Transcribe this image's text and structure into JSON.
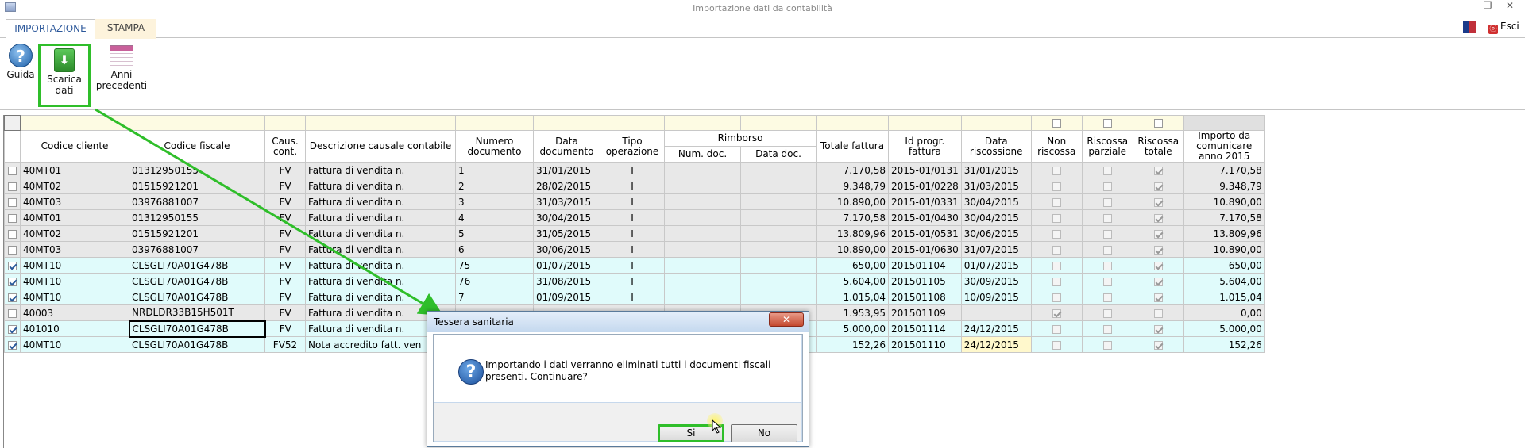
{
  "window": {
    "title": "Importazione dati da contabilità",
    "min": "–",
    "restore": "❐",
    "close": "✕"
  },
  "tabs": [
    {
      "label": "IMPORTAZIONE"
    },
    {
      "label": "STAMPA"
    }
  ],
  "toolbar": {
    "exit_label": "Esci",
    "exit_icon": "ⓞ",
    "guida": {
      "label": "Guida",
      "icon": "help-icon"
    },
    "scarica": {
      "label": "Scarica dati",
      "icon": "download-icon"
    },
    "anni": {
      "label": "Anni precedenti",
      "icon": "calendar-icon"
    }
  },
  "table": {
    "headers": {
      "codice_cliente": "Codice cliente",
      "codice_fiscale": "Codice fiscale",
      "caus_cont": "Caus. cont.",
      "descrizione": "Descrizione causale contabile",
      "numero_doc": "Numero documento",
      "data_doc": "Data documento",
      "tipo_op": "Tipo operazione",
      "rimborso": "Rimborso",
      "num_doc": "Num. doc.",
      "data_doc_r": "Data doc.",
      "totale": "Totale fattura",
      "id_progr": "Id progr. fattura",
      "data_risc": "Data riscossione",
      "non_risc": "Non riscossa",
      "risc_parz": "Riscossa parziale",
      "risc_tot": "Riscossa totale",
      "importo": "Importo da comunicare anno 2015"
    },
    "rows": [
      {
        "sel": false,
        "cliente": "40MT01",
        "cf": "01312950155",
        "caus": "FV",
        "desc": "Fattura di vendita n.",
        "num": "1",
        "data": "31/01/2015",
        "tipo": "I",
        "rnum": "",
        "rdata": "",
        "totale": "7.170,58",
        "id": "2015-01/0131",
        "drisc": "31/01/2015",
        "non": false,
        "parz": false,
        "tot": true,
        "importo": "7.170,58",
        "style": "r"
      },
      {
        "sel": false,
        "cliente": "40MT02",
        "cf": "01515921201",
        "caus": "FV",
        "desc": "Fattura di vendita n.",
        "num": "2",
        "data": "28/02/2015",
        "tipo": "I",
        "rnum": "",
        "rdata": "",
        "totale": "9.348,79",
        "id": "2015-01/0228",
        "drisc": "31/03/2015",
        "non": false,
        "parz": false,
        "tot": true,
        "importo": "9.348,79",
        "style": "r"
      },
      {
        "sel": false,
        "cliente": "40MT03",
        "cf": "03976881007",
        "caus": "FV",
        "desc": "Fattura di vendita n.",
        "num": "3",
        "data": "31/03/2015",
        "tipo": "I",
        "rnum": "",
        "rdata": "",
        "totale": "10.890,00",
        "id": "2015-01/0331",
        "drisc": "30/04/2015",
        "non": false,
        "parz": false,
        "tot": true,
        "importo": "10.890,00",
        "style": "r"
      },
      {
        "sel": false,
        "cliente": "40MT01",
        "cf": "01312950155",
        "caus": "FV",
        "desc": "Fattura di vendita n.",
        "num": "4",
        "data": "30/04/2015",
        "tipo": "I",
        "rnum": "",
        "rdata": "",
        "totale": "7.170,58",
        "id": "2015-01/0430",
        "drisc": "30/04/2015",
        "non": false,
        "parz": false,
        "tot": true,
        "importo": "7.170,58",
        "style": "r"
      },
      {
        "sel": false,
        "cliente": "40MT02",
        "cf": "01515921201",
        "caus": "FV",
        "desc": "Fattura di vendita n.",
        "num": "5",
        "data": "31/05/2015",
        "tipo": "I",
        "rnum": "",
        "rdata": "",
        "totale": "13.809,96",
        "id": "2015-01/0531",
        "drisc": "30/06/2015",
        "non": false,
        "parz": false,
        "tot": true,
        "importo": "13.809,96",
        "style": "r"
      },
      {
        "sel": false,
        "cliente": "40MT03",
        "cf": "03976881007",
        "caus": "FV",
        "desc": "Fattura di vendita n.",
        "num": "6",
        "data": "30/06/2015",
        "tipo": "I",
        "rnum": "",
        "rdata": "",
        "totale": "10.890,00",
        "id": "2015-01/0630",
        "drisc": "31/07/2015",
        "non": false,
        "parz": false,
        "tot": true,
        "importo": "10.890,00",
        "style": "r"
      },
      {
        "sel": true,
        "cliente": "40MT10",
        "cf": "CLSGLI70A01G478B",
        "caus": "FV",
        "desc": "Fattura di vendita n.",
        "num": "75",
        "data": "01/07/2015",
        "tipo": "I",
        "rnum": "",
        "rdata": "",
        "totale": "650,00",
        "id": "201501104",
        "drisc": "01/07/2015",
        "non": false,
        "parz": false,
        "tot": true,
        "importo": "650,00",
        "style": "cy"
      },
      {
        "sel": true,
        "cliente": "40MT10",
        "cf": "CLSGLI70A01G478B",
        "caus": "FV",
        "desc": "Fattura di vendita n.",
        "num": "76",
        "data": "31/08/2015",
        "tipo": "I",
        "rnum": "",
        "rdata": "",
        "totale": "5.604,00",
        "id": "201501105",
        "drisc": "30/09/2015",
        "non": false,
        "parz": false,
        "tot": true,
        "importo": "5.604,00",
        "style": "cy"
      },
      {
        "sel": true,
        "cliente": "40MT10",
        "cf": "CLSGLI70A01G478B",
        "caus": "FV",
        "desc": "Fattura di vendita n.",
        "num": "7",
        "data": "01/09/2015",
        "tipo": "I",
        "rnum": "",
        "rdata": "",
        "totale": "1.015,04",
        "id": "201501108",
        "drisc": "10/09/2015",
        "non": false,
        "parz": false,
        "tot": true,
        "importo": "1.015,04",
        "style": "cy"
      },
      {
        "sel": false,
        "cliente": "40003",
        "cf": "NRDLDR33B15H501T",
        "caus": "FV",
        "desc": "Fattura di vendita n.",
        "num": "",
        "data": "",
        "tipo": "",
        "rnum": "",
        "rdata": "",
        "totale": "1.953,95",
        "id": "201501109",
        "drisc": "",
        "non": true,
        "parz": false,
        "tot": false,
        "importo": "0,00",
        "style": "r"
      },
      {
        "sel": true,
        "cliente": "401010",
        "cf": "CLSGLI70A01G478B",
        "caus": "FV",
        "desc": "Fattura di vendita n.",
        "num": "",
        "data": "",
        "tipo": "",
        "rnum": "",
        "rdata": "",
        "totale": "5.000,00",
        "id": "201501114",
        "drisc": "24/12/2015",
        "non": false,
        "parz": false,
        "tot": true,
        "importo": "5.000,00",
        "style": "cy"
      },
      {
        "sel": true,
        "cliente": "40MT10",
        "cf": "CLSGLI70A01G478B",
        "caus": "FV52",
        "desc": "Nota accredito fatt. ven",
        "num": "",
        "data": "",
        "tipo": "",
        "rnum": "",
        "rdata": "",
        "totale": "152,26",
        "id": "201501110",
        "drisc": "24/12/2015",
        "non": false,
        "parz": false,
        "tot": true,
        "importo": "152,26",
        "style": "cy"
      }
    ]
  },
  "dialog": {
    "title": "Tessera sanitaria",
    "close": "✕",
    "icon": "question-icon",
    "message": "Importando i dati verranno eliminati tutti i documenti fiscali presenti. Continuare?",
    "yes_label": "Si",
    "no_label": "No"
  }
}
